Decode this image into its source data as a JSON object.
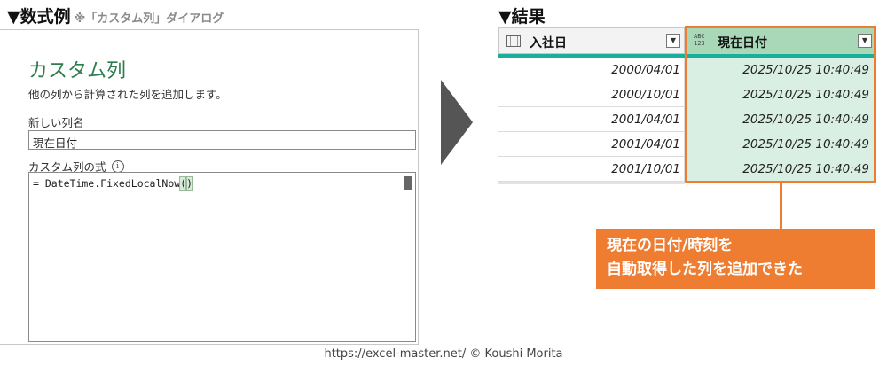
{
  "left_heading": {
    "main": "▼数式例",
    "sub": "※「カスタム列」ダイアログ"
  },
  "right_heading": "▼結果",
  "dialog": {
    "title": "カスタム列",
    "description": "他の列から計算された列を追加します。",
    "name_label": "新しい列名",
    "name_value": "現在日付",
    "formula_label": "カスタム列の式",
    "formula_prefix": "= DateTime.FixedLocalNow",
    "formula_paren_open": "(",
    "formula_paren_close": ")"
  },
  "table": {
    "columns": [
      {
        "label": "入社日",
        "icon": "calendar-icon"
      },
      {
        "label": "現在日付",
        "icon": "abc-123-icon"
      }
    ],
    "rows": [
      [
        "2000/04/01",
        "2025/10/25 10:40:49"
      ],
      [
        "2000/10/01",
        "2025/10/25 10:40:49"
      ],
      [
        "2001/04/01",
        "2025/10/25 10:40:49"
      ],
      [
        "2001/04/01",
        "2025/10/25 10:40:49"
      ],
      [
        "2001/10/01",
        "2025/10/25 10:40:49"
      ]
    ],
    "accent_color": "#1aaf9a",
    "highlight_color": "#ee7d31"
  },
  "callout": {
    "line1": "現在の日付/時刻を",
    "line2": "自動取得した列を追加できた"
  },
  "footer": "https://excel-master.net/  © Koushi Morita"
}
